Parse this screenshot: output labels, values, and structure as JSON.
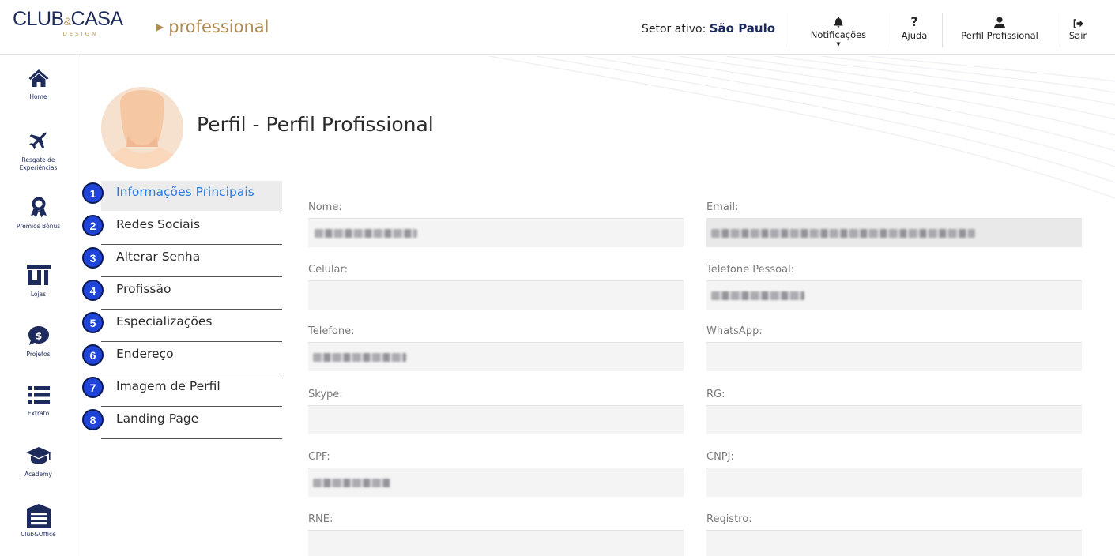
{
  "header": {
    "logo_club": "CLUB",
    "logo_amp": "&",
    "logo_casa": "CASA",
    "logo_sub": "DESIGN",
    "product": "professional",
    "setor_label": "Setor ativo:",
    "setor_value": "São Paulo",
    "nav": [
      {
        "label": "Notificações",
        "icon": "bell-icon"
      },
      {
        "label": "Ajuda",
        "icon": "question-icon"
      },
      {
        "label": "Perfil Profissional",
        "icon": "user-icon"
      },
      {
        "label": "Sair",
        "icon": "sign-out-icon"
      }
    ]
  },
  "sidebar": {
    "items": [
      {
        "label": "Home",
        "icon": "home-icon"
      },
      {
        "label": "Resgate de Experiências",
        "icon": "plane-icon"
      },
      {
        "label": "Prêmios Bônus",
        "icon": "award-icon"
      },
      {
        "label": "Lojas",
        "icon": "store-icon"
      },
      {
        "label": "Projetos",
        "icon": "money-bubble-icon"
      },
      {
        "label": "Extrato",
        "icon": "list-icon"
      },
      {
        "label": "Academy",
        "icon": "graduation-cap-icon"
      },
      {
        "label": "Club&Office",
        "icon": "warehouse-icon"
      }
    ]
  },
  "page": {
    "title": "Perfil - Perfil Profissional"
  },
  "steps": [
    {
      "num": "1",
      "label": "Informações Principais",
      "active": true
    },
    {
      "num": "2",
      "label": "Redes Sociais"
    },
    {
      "num": "3",
      "label": "Alterar Senha"
    },
    {
      "num": "4",
      "label": "Profissão"
    },
    {
      "num": "5",
      "label": "Especializações"
    },
    {
      "num": "6",
      "label": "Endereço"
    },
    {
      "num": "7",
      "label": "Imagem de Perfil"
    },
    {
      "num": "8",
      "label": "Landing Page"
    }
  ],
  "form": {
    "nome": "Nome:",
    "email": "Email:",
    "celular": "Celular:",
    "telefone_pessoal": "Telefone Pessoal:",
    "telefone": "Telefone:",
    "whatsapp": "WhatsApp:",
    "skype": "Skype:",
    "rg": "RG:",
    "cpf": "CPF:",
    "cnpj": "CNPJ:",
    "rne": "RNE:",
    "registro": "Registro:"
  },
  "colors": {
    "navy": "#1d2a5c",
    "gold": "#b08b52",
    "accent_blue": "#2a7be4",
    "step_badge": "#1f44d8"
  }
}
